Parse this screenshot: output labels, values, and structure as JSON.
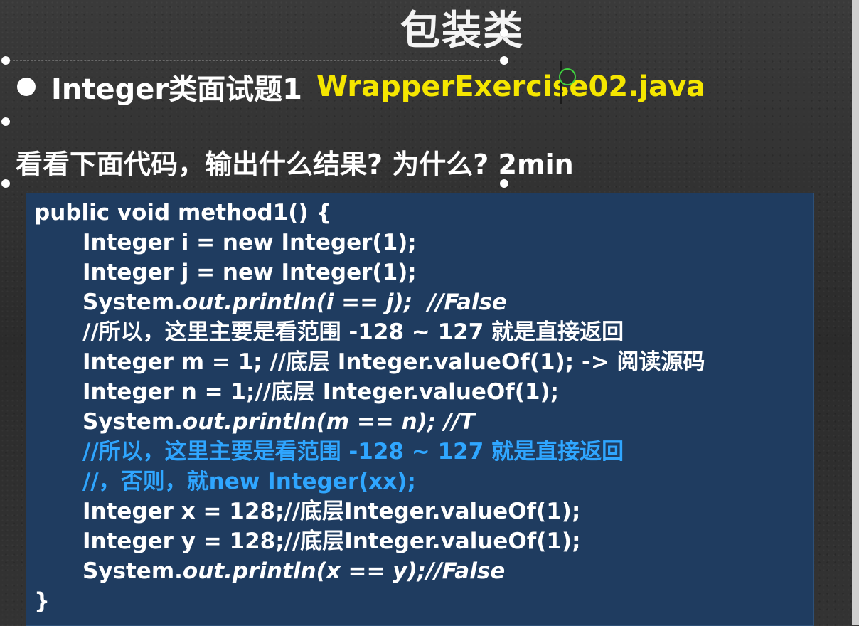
{
  "slide": {
    "title": "包装类",
    "bullet_text": "Integer类面试题1",
    "bullet_file": "WrapperExercise02.java",
    "question": "看看下面代码，输出什么结果? 为什么? 2min"
  },
  "code": {
    "l1": "public void method1() {",
    "l2": "Integer i = new Integer(1);",
    "l3": "Integer j = new Integer(1);",
    "l4_a": "System.",
    "l4_b": "out.println(i == j);  //False",
    "l5": "//所以，这里主要是看范围 -128 ~ 127 就是直接返回",
    "l6": "Integer m = 1; //底层 Integer.valueOf(1); -> 阅读源码",
    "l7": "Integer n = 1;//底层 Integer.valueOf(1);",
    "l8_a": "System.",
    "l8_b": "out.println(m == n); //T",
    "l9": "//所以，这里主要是看范围 -128 ~ 127 就是直接返回",
    "l10": "//，否则，就new Integer(xx);",
    "l11": "Integer x = 128;//底层Integer.valueOf(1);",
    "l12": "Integer y = 128;//底层Integer.valueOf(1);",
    "l13_a": "System.",
    "l13_b": "out.println(x == y);//False",
    "l14": "}"
  },
  "colors": {
    "background": "#2f2f2f",
    "code_box": "#1f3c60",
    "filename_yellow": "#f5e600",
    "comment_blue": "#2fa6ff"
  }
}
